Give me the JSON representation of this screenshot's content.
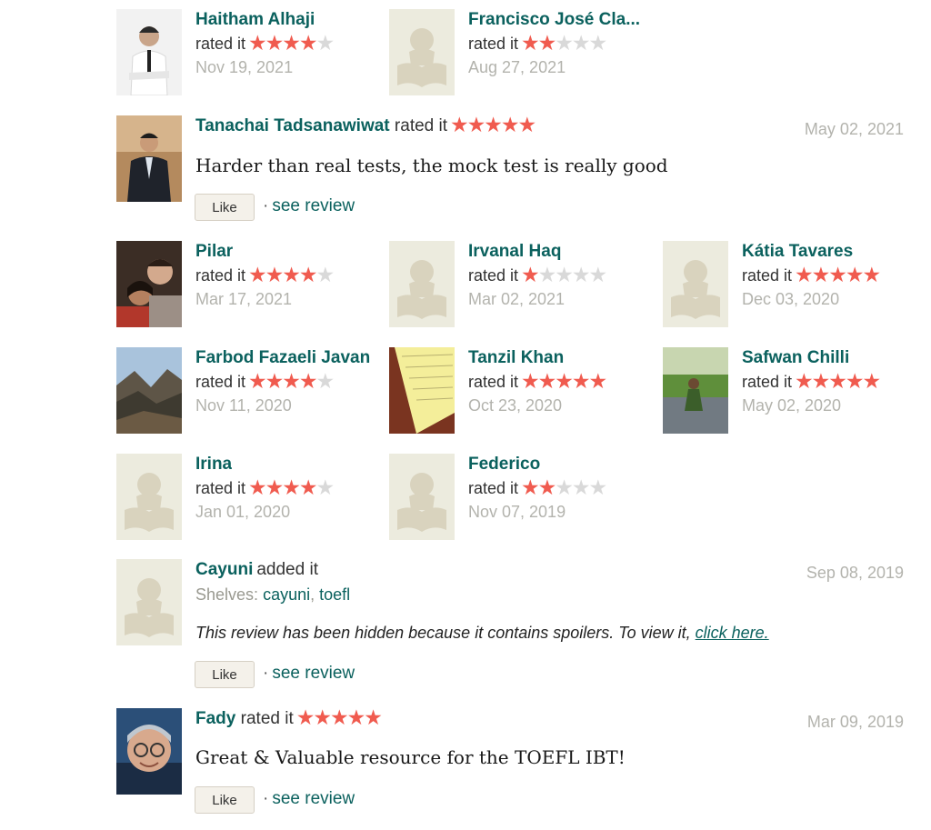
{
  "colors": {
    "link": "#0b615e",
    "star_on": "#f05b4f",
    "star_off": "#d9d9d9",
    "date": "#b3b3ad",
    "placeholder_bg": "#ecebde",
    "placeholder_fg": "#d9d3be"
  },
  "labels": {
    "rated_it": "rated it",
    "like": "Like",
    "see_review": "see review",
    "dot": "·",
    "shelves": "Shelves:"
  },
  "star_glyph": "★",
  "grid_row1": [
    {
      "name": "Haitham Alhaji",
      "rating": 4,
      "date": "Nov 19, 2021",
      "avatar": "photo-man-suit"
    },
    {
      "name": "Francisco José Cla...",
      "rating": 2,
      "date": "Aug 27, 2021",
      "avatar": "placeholder"
    }
  ],
  "review1": {
    "name": "Tanachai Tadsanawiwat",
    "rating": 5,
    "date": "May 02, 2021",
    "text": "Harder than real tests, the mock test is really good",
    "avatar": "photo-man-suit-dark"
  },
  "grid_row2": [
    {
      "name": "Pilar",
      "rating": 4,
      "date": "Mar 17, 2021",
      "avatar": "photo-couple"
    },
    {
      "name": "Irvanal Haq",
      "rating": 1,
      "date": "Mar 02, 2021",
      "avatar": "placeholder"
    },
    {
      "name": "Kátia Tavares",
      "rating": 5,
      "date": "Dec 03, 2020",
      "avatar": "placeholder"
    }
  ],
  "grid_row3": [
    {
      "name": "Farbod Fazaeli Javan",
      "rating": 4,
      "date": "Nov 11, 2020",
      "avatar": "photo-mountains"
    },
    {
      "name": "Tanzil Khan",
      "rating": 5,
      "date": "Oct 23, 2020",
      "avatar": "photo-notebook"
    },
    {
      "name": "Safwan Chilli",
      "rating": 5,
      "date": "May 02, 2020",
      "avatar": "photo-garden"
    }
  ],
  "grid_row4": [
    {
      "name": "Irina",
      "rating": 4,
      "date": "Jan 01, 2020",
      "avatar": "placeholder"
    },
    {
      "name": "Federico",
      "rating": 2,
      "date": "Nov 07, 2019",
      "avatar": "placeholder"
    }
  ],
  "review2": {
    "name": "Cayuni",
    "action": "added it",
    "date": "Sep 08, 2019",
    "shelves": [
      "cayuni",
      "toefl"
    ],
    "spoiler_text": "This review has been hidden because it contains spoilers. To view it,",
    "spoiler_link": "click here.",
    "avatar": "placeholder"
  },
  "review3": {
    "name": "Fady",
    "rating": 5,
    "date": "Mar 09, 2019",
    "text": "Great & Valuable resource for the TOEFL IBT!",
    "avatar": "photo-man-glasses"
  }
}
